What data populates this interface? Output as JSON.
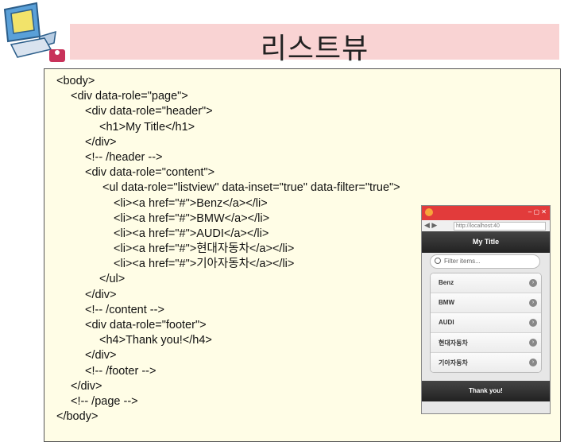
{
  "slide": {
    "title": "리스트뷰"
  },
  "code_lines": [
    {
      "indent": 0,
      "text": "<body>"
    },
    {
      "indent": 18,
      "text": "<div data-role=\"page\">"
    },
    {
      "indent": 36,
      "text": "<div data-role=\"header\">"
    },
    {
      "indent": 54,
      "text": "<h1>My Title</h1>"
    },
    {
      "indent": 36,
      "text": "</div>"
    },
    {
      "indent": 36,
      "text": "<!-- /header -->"
    },
    {
      "indent": 36,
      "text": "<div data-role=\"content\">"
    },
    {
      "indent": 58,
      "text": "<ul data-role=\"listview\" data-inset=\"true\" data-filter=\"true\">"
    },
    {
      "indent": 72,
      "text": "<li><a href=\"#\">Benz</a></li>"
    },
    {
      "indent": 72,
      "text": "<li><a href=\"#\">BMW</a></li>"
    },
    {
      "indent": 72,
      "text": "<li><a href=\"#\">AUDI</a></li>"
    },
    {
      "indent": 72,
      "text": "<li><a href=\"#\">현대자동차</a></li>"
    },
    {
      "indent": 72,
      "text": "<li><a href=\"#\">기아자동차</a></li>"
    },
    {
      "indent": 54,
      "text": "</ul>"
    },
    {
      "indent": 36,
      "text": "</div>"
    },
    {
      "indent": 36,
      "text": "<!-- /content -->"
    },
    {
      "indent": 36,
      "text": "<div data-role=\"footer\">"
    },
    {
      "indent": 54,
      "text": "<h4>Thank you!</h4>"
    },
    {
      "indent": 36,
      "text": "</div>"
    },
    {
      "indent": 36,
      "text": "<!-- /footer -->"
    },
    {
      "indent": 18,
      "text": "</div>"
    },
    {
      "indent": 18,
      "text": "<!-- /page -->"
    },
    {
      "indent": 0,
      "text": "</body>"
    }
  ],
  "phone": {
    "address": "http://localhost:40",
    "header_title": "My Title",
    "filter_placeholder": "Filter items...",
    "items": [
      "Benz",
      "BMW",
      "AUDI",
      "현대자동차",
      "기아자동차"
    ],
    "footer_text": "Thank you!"
  },
  "colors": {
    "title_bg": "#f9d3d3",
    "code_bg": "#fffde6",
    "browser_chrome": "#e23b3b"
  }
}
